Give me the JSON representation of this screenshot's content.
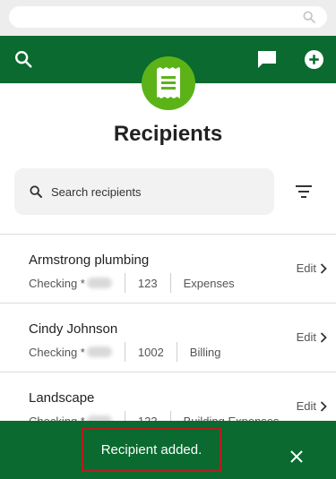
{
  "colors": {
    "brand_green": "#0a6a2f",
    "logo_green": "#5cb318",
    "highlight_red": "#b71c1c"
  },
  "page": {
    "title": "Recipients"
  },
  "search": {
    "placeholder": "Search recipients"
  },
  "icons": {
    "header_left": "search-icon",
    "header_right": [
      "chat-icon",
      "add-circle-icon"
    ],
    "logo": "receipt-icon",
    "filter": "filter-icon"
  },
  "recipients": [
    {
      "name": "Armstrong plumbing",
      "account": "Checking *",
      "number": "123",
      "category": "Expenses",
      "action": "Edit"
    },
    {
      "name": "Cindy Johnson",
      "account": "Checking *",
      "number": "1002",
      "category": "Billing",
      "action": "Edit"
    },
    {
      "name": "Landscape",
      "account": "Checking *",
      "number": "123",
      "category": "Building Expenses",
      "action": "Edit"
    }
  ],
  "toast": {
    "message": "Recipient added."
  }
}
